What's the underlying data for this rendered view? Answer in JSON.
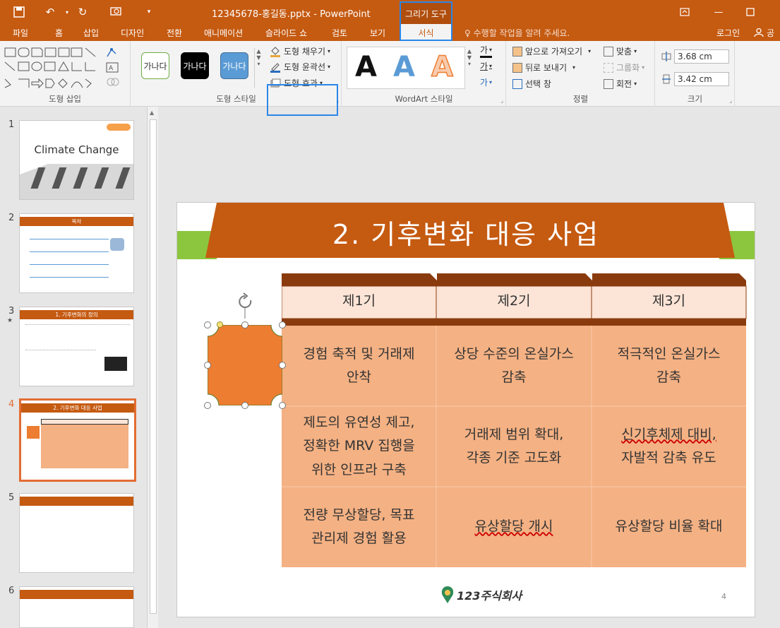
{
  "app": {
    "doc_title": "12345678-홍길동.pptx - PowerPoint",
    "context_tab_header": "그리기 도구"
  },
  "tabs": [
    {
      "label": "파일"
    },
    {
      "label": "홈"
    },
    {
      "label": "삽입"
    },
    {
      "label": "디자인"
    },
    {
      "label": "전환"
    },
    {
      "label": "애니메이션"
    },
    {
      "label": "슬라이드 쇼"
    },
    {
      "label": "검토"
    },
    {
      "label": "보기"
    }
  ],
  "active_tab": "서식",
  "tell_me": "수행할 작업을 알려 주세요.",
  "login": "로그인",
  "share": "공유",
  "ribbon": {
    "groups": {
      "insert_shapes": "도형 삽입",
      "shape_styles": "도형 스타일",
      "wordart_styles": "WordArt 스타일",
      "arrange": "정렬",
      "size": "크기"
    },
    "style_previews": [
      "가나다",
      "가나다",
      "가나다"
    ],
    "shape_fill": "도형 채우기",
    "shape_outline": "도형 윤곽선",
    "shape_effects": "도형 효과",
    "wordart_letter": "A",
    "text_btns": [
      "가",
      "가",
      "가"
    ],
    "bring_forward": "앞으로 가져오기",
    "send_backward": "뒤로 보내기",
    "selection_pane": "선택 창",
    "align": "맞춤",
    "group": "그룹화",
    "rotate": "회전",
    "height": "3.68 cm",
    "width": "3.42 cm"
  },
  "thumbnails": [
    {
      "num": "1",
      "title": "Climate Change"
    },
    {
      "num": "2",
      "title": "목차"
    },
    {
      "num": "3",
      "title": "1. 기후변화의 정의"
    },
    {
      "num": "4",
      "title": "2. 기후변화 대응 사업"
    },
    {
      "num": "5",
      "title": ""
    },
    {
      "num": "6",
      "title": ""
    }
  ],
  "thumb3_star": "★",
  "slide": {
    "title": "2. 기후변화 대응 사업",
    "page_number": "4",
    "logo_text": "123주식회사",
    "table": {
      "headers": [
        "제1기",
        "제2기",
        "제3기"
      ],
      "rows": [
        [
          {
            "l1": "경험 축적 및 거래제",
            "l2": "안착"
          },
          {
            "l1": "상당 수준의 온실가스",
            "l2": "감축"
          },
          {
            "l1": "적극적인 온실가스",
            "l2": "감축"
          }
        ],
        [
          {
            "l1": "제도의 유연성 제고,",
            "l2": "정확한 MRV 집행을",
            "l3": "위한 인프라 구축"
          },
          {
            "l1": "거래제 범위 확대,",
            "l2": "각종 기준 고도화"
          },
          {
            "l1": "신기후체제 대비,",
            "l2": "자발적 감축 유도"
          }
        ],
        [
          {
            "l1": "전량 무상할당, 목표",
            "l2": "관리제 경험 활용"
          },
          {
            "l1": "유상할당 개시"
          },
          {
            "l1": "유상할당 비율 확대"
          }
        ]
      ]
    }
  },
  "colors": {
    "accent": "#c55a11",
    "green": "#8cc63f",
    "header_fill": "#fce4d6",
    "cell_fill": "#f4b183",
    "cell_fill_dark": "#eea07a",
    "shape_fill": "#ed7d31",
    "highlight_blue": "#2a86e8"
  }
}
